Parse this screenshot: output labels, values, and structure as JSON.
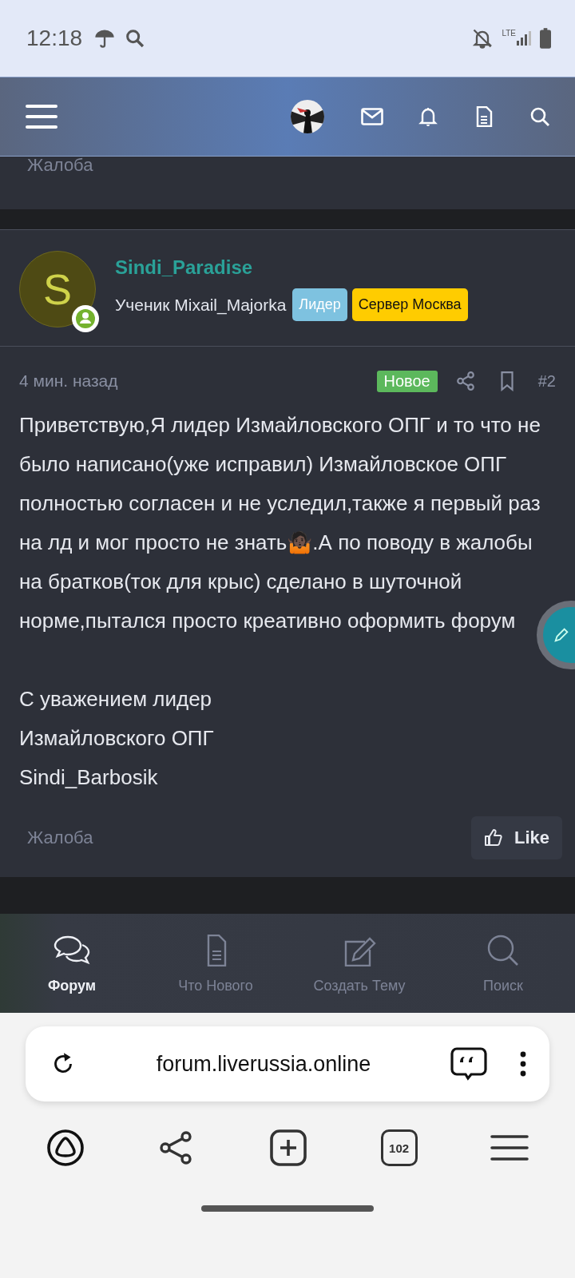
{
  "status_bar": {
    "time": "12:18",
    "network": "LTE"
  },
  "previous_post": {
    "report_link": "Жалоба"
  },
  "post": {
    "author": {
      "avatar_letter": "S",
      "name": "Sindi_Paradise",
      "title": "Ученик Mixail_Majorka",
      "online": true,
      "badges": [
        {
          "label": "Лидер",
          "color": "#7ec2e0"
        },
        {
          "label": "Сервер Москва",
          "color": "#ffcc00"
        }
      ]
    },
    "time": "4 мин. назад",
    "new_badge": "Новое",
    "number": "#2",
    "paragraphs": [
      "Приветствую,Я лидер Измайловского ОПГ и то что не было написано(уже исправил) Измайловское ОПГ полностью согласен и не уследил,также я первый раз на лд и мог просто не знать🤷🏿.А по поводу в жалобы на братков(ток для крыс) сделано в шуточной норме,пытался просто креативно оформить форум",
      "С уважением лидер\nИзмайловского ОПГ\nSindi_Barbosik"
    ],
    "report_link": "Жалоба",
    "like_button": "Like"
  },
  "bottom_nav": [
    {
      "kind": "forum",
      "label": "Форум",
      "selected": true
    },
    {
      "kind": "whats_new",
      "label": "Что Нового",
      "selected": false
    },
    {
      "kind": "create",
      "label": "Создать Тему",
      "selected": false
    },
    {
      "kind": "search",
      "label": "Поиск",
      "selected": false
    }
  ],
  "browser": {
    "url": "forum.liverussia.online",
    "tabs_count": "102"
  }
}
